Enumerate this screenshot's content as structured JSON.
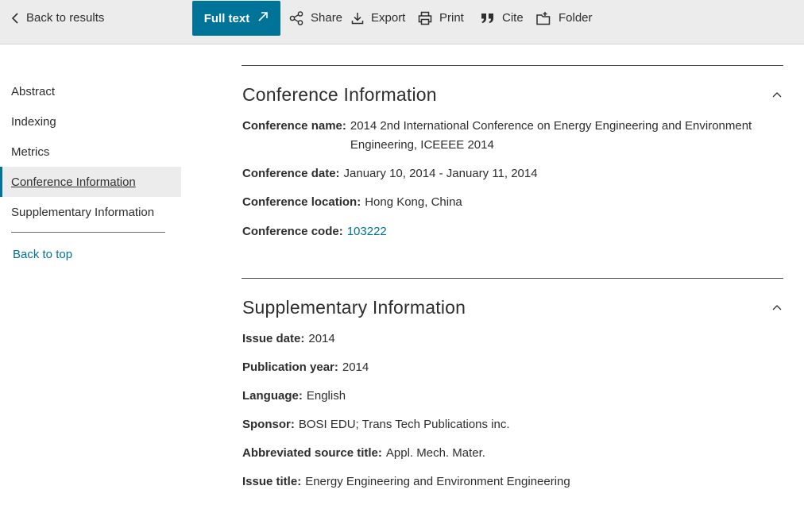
{
  "toolbar": {
    "back_label": "Back to results",
    "fulltext_label": "Full text",
    "share_label": "Share",
    "export_label": "Export",
    "print_label": "Print",
    "cite_label": "Cite",
    "folder_label": "Folder",
    "accent": "#007398"
  },
  "sidebar": {
    "items": [
      {
        "label": "Abstract"
      },
      {
        "label": "Indexing"
      },
      {
        "label": "Metrics"
      },
      {
        "label": "Conference Information"
      },
      {
        "label": "Supplementary Information"
      }
    ],
    "active_item": "Conference Information",
    "back_to_top": "Back to top"
  },
  "conference": {
    "title": "Conference Information",
    "name_key": "Conference name:",
    "name_value": "2014 2nd International Conference on Energy Engineering and Environment Engineering, ICEEEE 2014",
    "date_key": "Conference date:",
    "date_value": "January 10, 2014 - January 11, 2014",
    "location_key": "Conference location:",
    "location_value": "Hong Kong, China",
    "code_key": "Conference code:",
    "code_value": "103222"
  },
  "supplementary": {
    "title": "Supplementary Information",
    "issue_date_key": "Issue date:",
    "issue_date_value": "2014",
    "pub_year_key": "Publication year:",
    "pub_year_value": "2014",
    "language_key": "Language:",
    "language_value": "English",
    "sponsor_key": "Sponsor:",
    "sponsor_value": "BOSI EDU; Trans Tech Publications inc.",
    "abbrev_key": "Abbreviated source title:",
    "abbrev_value": "Appl. Mech. Mater.",
    "issue_title_key": "Issue title:",
    "issue_title_value": "Energy Engineering and Environment Engineering"
  }
}
